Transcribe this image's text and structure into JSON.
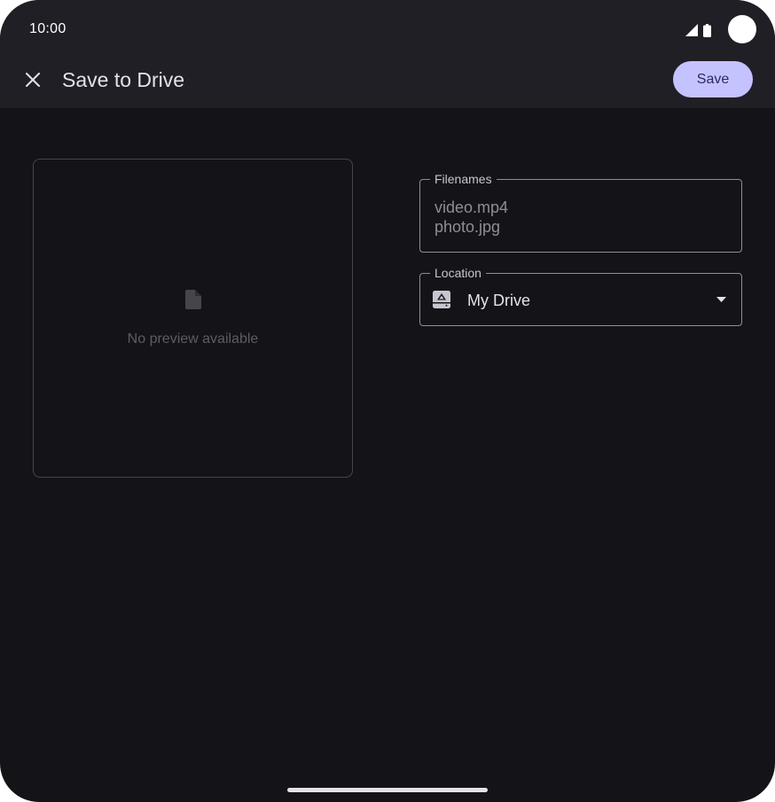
{
  "status_bar": {
    "time": "10:00",
    "icons": [
      "signal-icon",
      "battery-icon",
      "camera-cutout"
    ]
  },
  "header": {
    "close_icon": "close-icon",
    "title": "Save to Drive",
    "save_label": "Save"
  },
  "preview": {
    "icon": "file-icon",
    "message": "No preview available"
  },
  "form": {
    "filenames": {
      "label": "Filenames",
      "value": "video.mp4\nphoto.jpg"
    },
    "location": {
      "label": "Location",
      "icon": "drive-icon",
      "value": "My Drive",
      "dropdown_icon": "dropdown-arrow-icon"
    }
  },
  "colors": {
    "background": "#141318",
    "top_bar": "#201f26",
    "accent": "#c5c3ff",
    "text_primary": "#e6e1e9",
    "text_muted": "#8f8e96"
  }
}
